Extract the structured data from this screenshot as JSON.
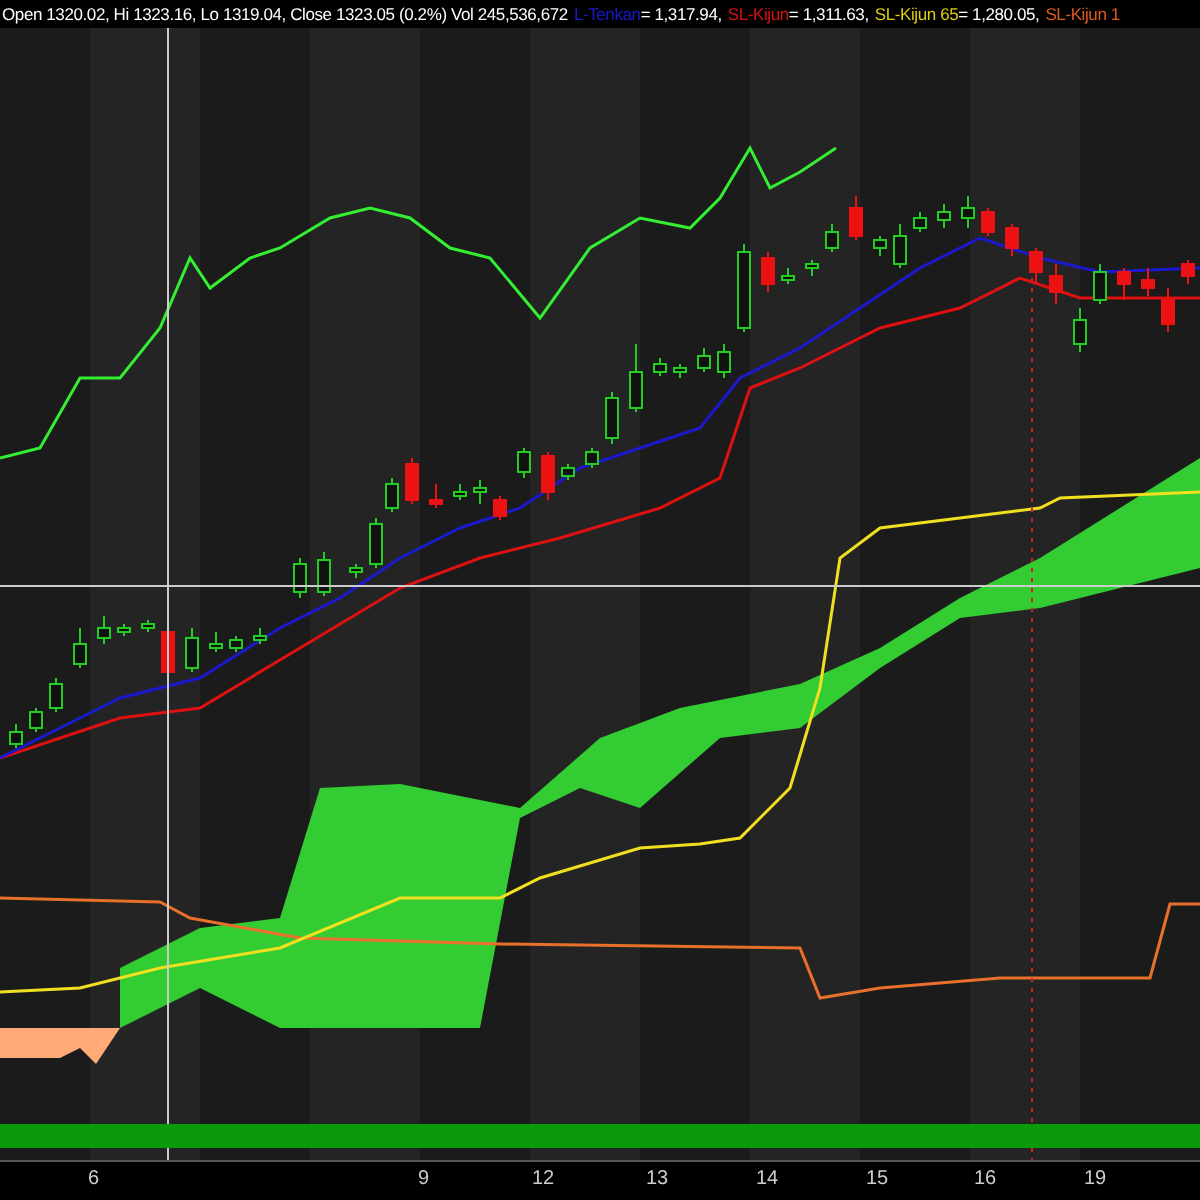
{
  "legend": {
    "ohlc": "Open 1320.02, Hi 1323.16, Lo 1319.04, Close 1323.05 (0.2%) Vol 245,536,672",
    "items": [
      {
        "label": "L-Tenkan",
        "value": " = 1,317.94,",
        "color": "#1a1acc"
      },
      {
        "label": "SL-Kijun",
        "value": " = 1,311.63,",
        "color": "#dd1111"
      },
      {
        "label": "SL-Kijun 65",
        "value": " = 1,280.05,",
        "color": "#e0cc10"
      },
      {
        "label": "SL-Kijun 1",
        "value": "",
        "color": "#e05a20"
      }
    ]
  },
  "x_axis": {
    "labels": [
      "6",
      "9",
      "12",
      "13",
      "14",
      "15",
      "16",
      "19"
    ]
  }
}
